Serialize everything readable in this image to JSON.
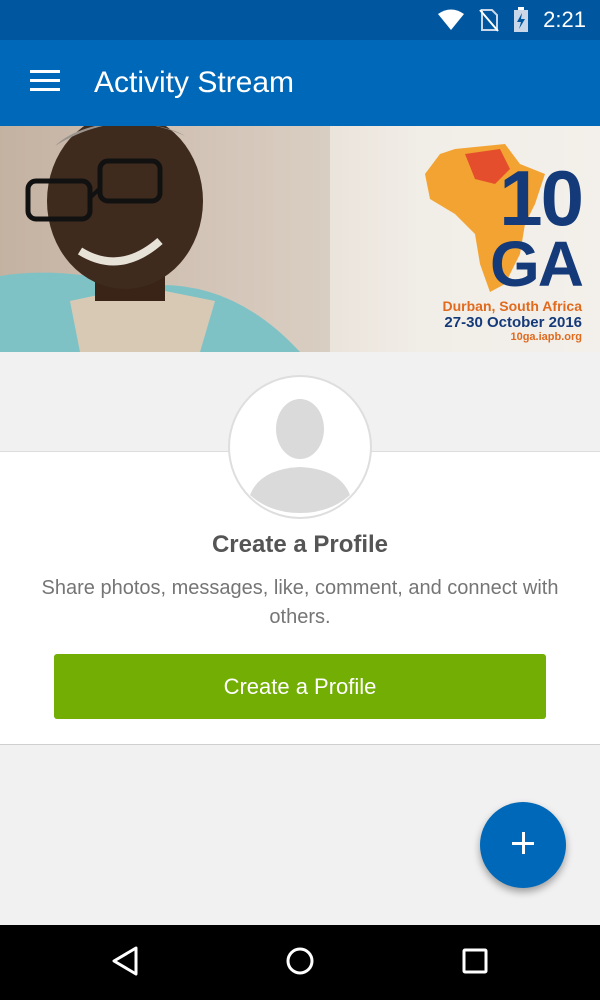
{
  "status_bar": {
    "time": "2:21",
    "icons": [
      "wifi-icon",
      "no-sim-icon",
      "battery-charging-icon"
    ]
  },
  "app_bar": {
    "title": "Activity Stream",
    "menu_icon": "hamburger-menu-icon",
    "color": "#0068b8"
  },
  "banner": {
    "logo_number": "10",
    "logo_letters": "GA",
    "location": "Durban, South Africa",
    "dates": "27-30 October 2016",
    "url": "10ga.iapb.org"
  },
  "profile_card": {
    "avatar_icon": "default-avatar-icon",
    "title": "Create a Profile",
    "description": "Share photos, messages, like, comment, and connect with others.",
    "button_label": "Create a Profile",
    "button_color": "#72ae04"
  },
  "fab": {
    "icon": "plus-icon",
    "color": "#0068b8"
  },
  "nav_bar": {
    "icons": [
      "back-icon",
      "home-icon",
      "recents-icon"
    ]
  }
}
